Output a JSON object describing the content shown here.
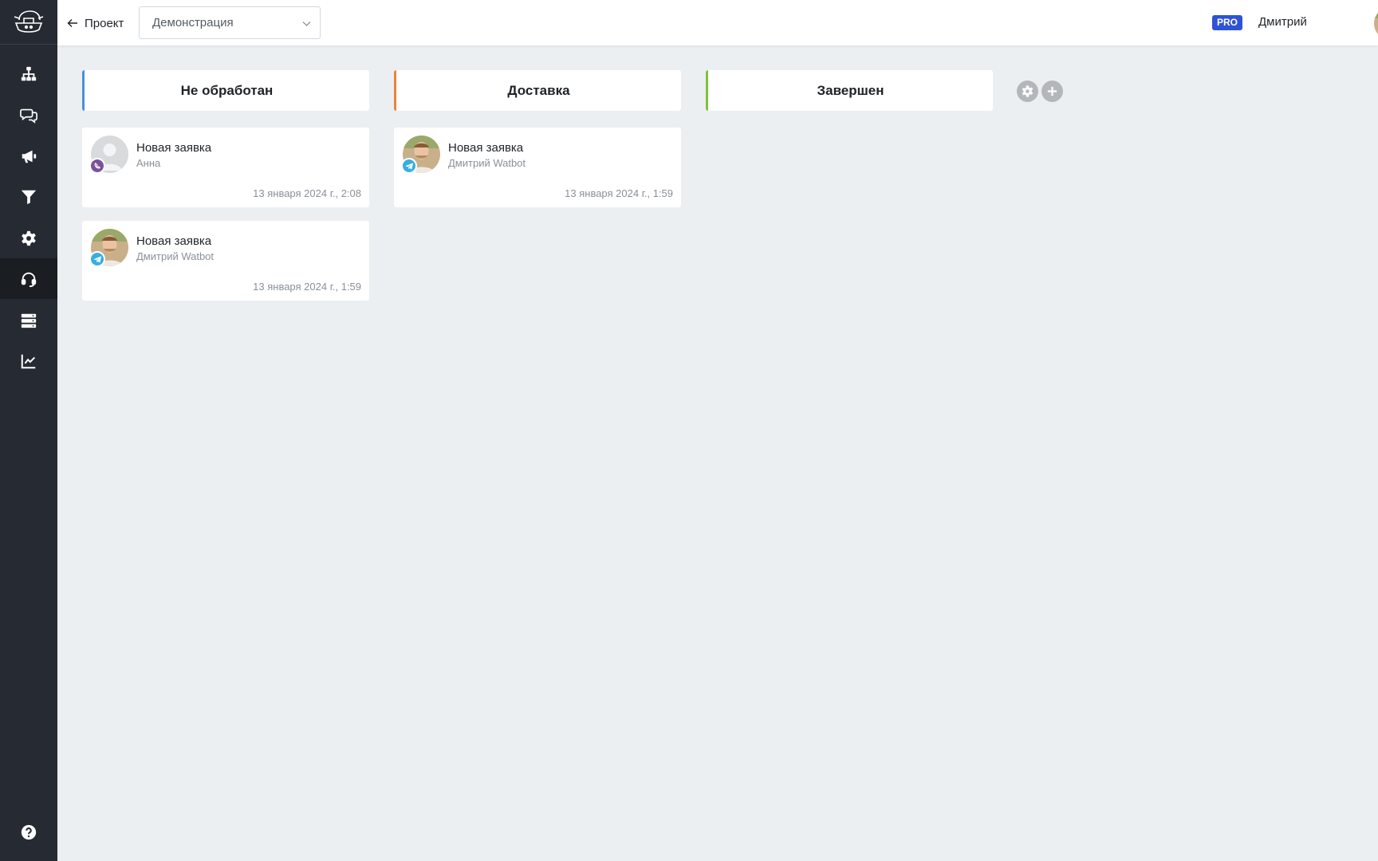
{
  "colors": {
    "sidebar": "#262b33",
    "sidebar_active": "#1a1d22",
    "background": "#eceff1",
    "pro_badge": "#2f53d6",
    "column_unprocessed": "#4a90d9",
    "column_delivery": "#e8833a",
    "column_done": "#7cc33b",
    "viber": "#7b519d",
    "telegram": "#37aee2"
  },
  "sidebar": {
    "items": [
      {
        "icon": "sitemap-icon"
      },
      {
        "icon": "chat-bubbles-icon"
      },
      {
        "icon": "megaphone-icon"
      },
      {
        "icon": "filter-icon"
      },
      {
        "icon": "gear-icon"
      },
      {
        "icon": "headset-icon",
        "active": true
      },
      {
        "icon": "database-icon"
      },
      {
        "icon": "chart-line-icon"
      }
    ],
    "bottom_icon": "help-icon"
  },
  "header": {
    "back_label": "Проект",
    "project_select_value": "Демонстрация",
    "badge": "PRO",
    "user_name": "Дмитрий"
  },
  "board": {
    "columns": [
      {
        "title": "Не обработан",
        "cards": [
          {
            "title": "Новая заявка",
            "subtitle": "Анна",
            "date": "13 января 2024 г., 2:08",
            "channel": "viber"
          },
          {
            "title": "Новая заявка",
            "subtitle": "Дмитрий Watbot",
            "date": "13 января 2024 г., 1:59",
            "channel": "telegram"
          }
        ]
      },
      {
        "title": "Доставка",
        "cards": [
          {
            "title": "Новая заявка",
            "subtitle": "Дмитрий Watbot",
            "date": "13 января 2024 г., 1:59",
            "channel": "telegram"
          }
        ]
      },
      {
        "title": "Завершен",
        "cards": []
      }
    ],
    "tools": [
      "settings-icon",
      "add-icon"
    ]
  }
}
